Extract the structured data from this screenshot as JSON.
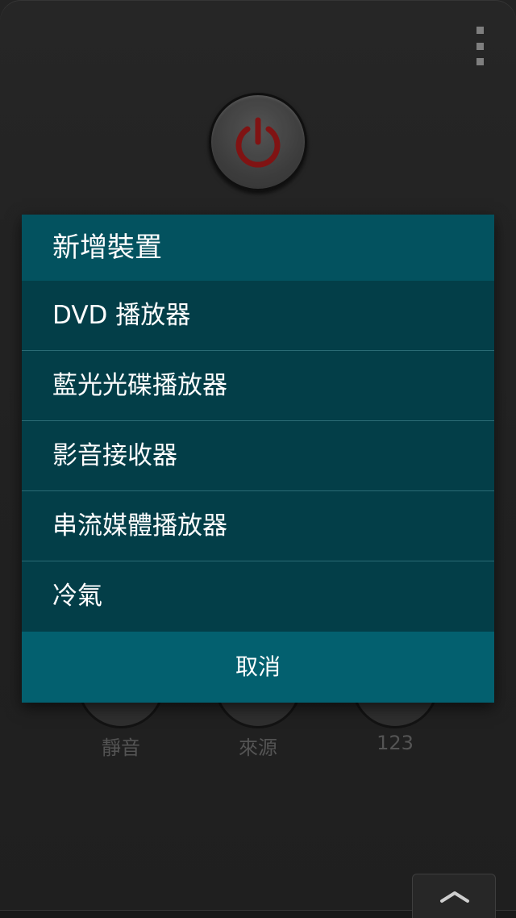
{
  "remote": {
    "buttons": [
      {
        "label": "靜音"
      },
      {
        "label": "來源"
      },
      {
        "label": "123"
      }
    ]
  },
  "dialog": {
    "title": "新增裝置",
    "items": [
      {
        "label": "DVD 播放器"
      },
      {
        "label": "藍光光碟播放器"
      },
      {
        "label": "影音接收器"
      },
      {
        "label": "串流媒體播放器"
      },
      {
        "label": "冷氣"
      }
    ],
    "cancel_label": "取消"
  },
  "icons": {
    "overflow": "more-vertical-icon",
    "power": "power-icon",
    "expand": "chevron-up-icon"
  },
  "colors": {
    "dialog_title_bg": "#03525f",
    "dialog_list_bg": "#033e48",
    "dialog_cancel_bg": "#03606f",
    "power_icon": "#8b1515"
  }
}
